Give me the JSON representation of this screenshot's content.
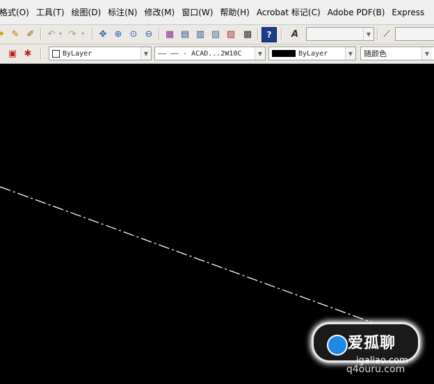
{
  "menubar": {
    "items": [
      {
        "label": "格式(O)"
      },
      {
        "label": "工具(T)"
      },
      {
        "label": "绘图(D)"
      },
      {
        "label": "标注(N)"
      },
      {
        "label": "修改(M)"
      },
      {
        "label": "窗口(W)"
      },
      {
        "label": "帮助(H)"
      },
      {
        "label": "Acrobat 标记(C)"
      },
      {
        "label": "Adobe PDF(B)"
      },
      {
        "label": "Express"
      }
    ]
  },
  "toolbar_properties": {
    "layer_combo": "ByLayer",
    "linetype_combo": "—— —— - ACAD...2W10C",
    "lineweight_combo": "ByLayer",
    "plotstyle_combo": "随颜色"
  },
  "watermark": {
    "title": "爱孤聊",
    "url": "igaliao.com",
    "url2": "q4ouru.com"
  },
  "colors": {
    "canvas": "#000000",
    "line": "#ffffff",
    "chrome": "#ece9e4"
  }
}
